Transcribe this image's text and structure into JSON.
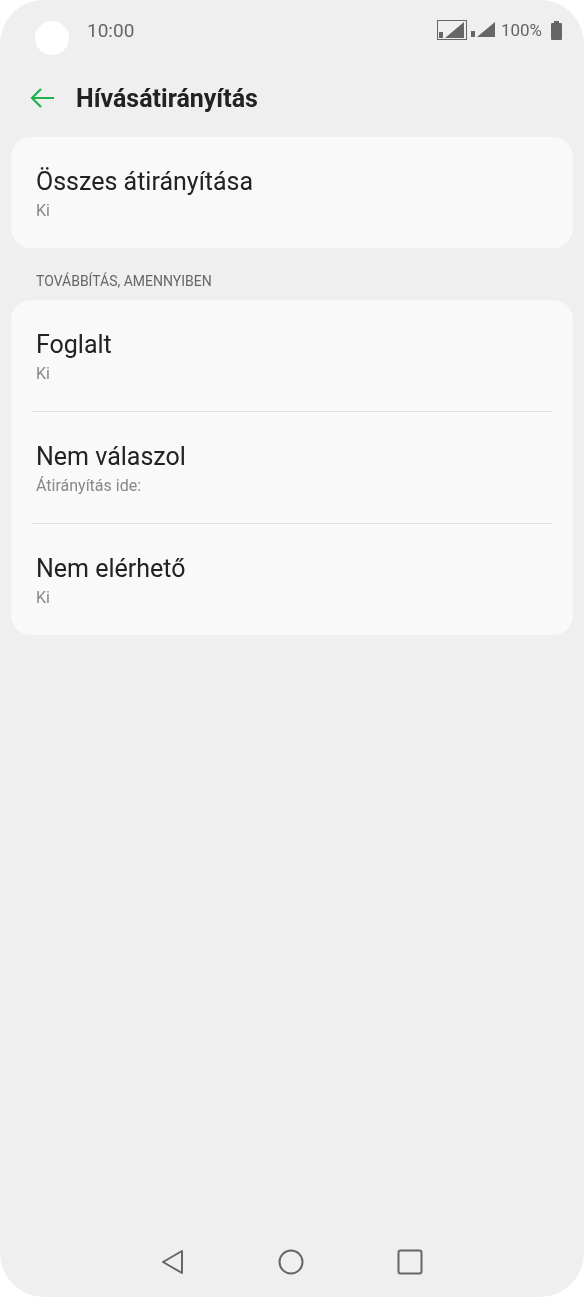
{
  "status_bar": {
    "time": "10:00",
    "battery": "100%"
  },
  "header": {
    "title": "Hívásátirányítás"
  },
  "groups": [
    {
      "items": [
        {
          "title": "Összes átirányítása",
          "summary": "Ki"
        }
      ]
    },
    {
      "heading": "TOVÁBBÍTÁS, AMENNYIBEN",
      "items": [
        {
          "title": "Foglalt",
          "summary": "Ki"
        },
        {
          "title": "Nem válaszol",
          "summary": "Átirányítás ide:"
        },
        {
          "title": "Nem elérhető",
          "summary": "Ki"
        }
      ]
    }
  ]
}
